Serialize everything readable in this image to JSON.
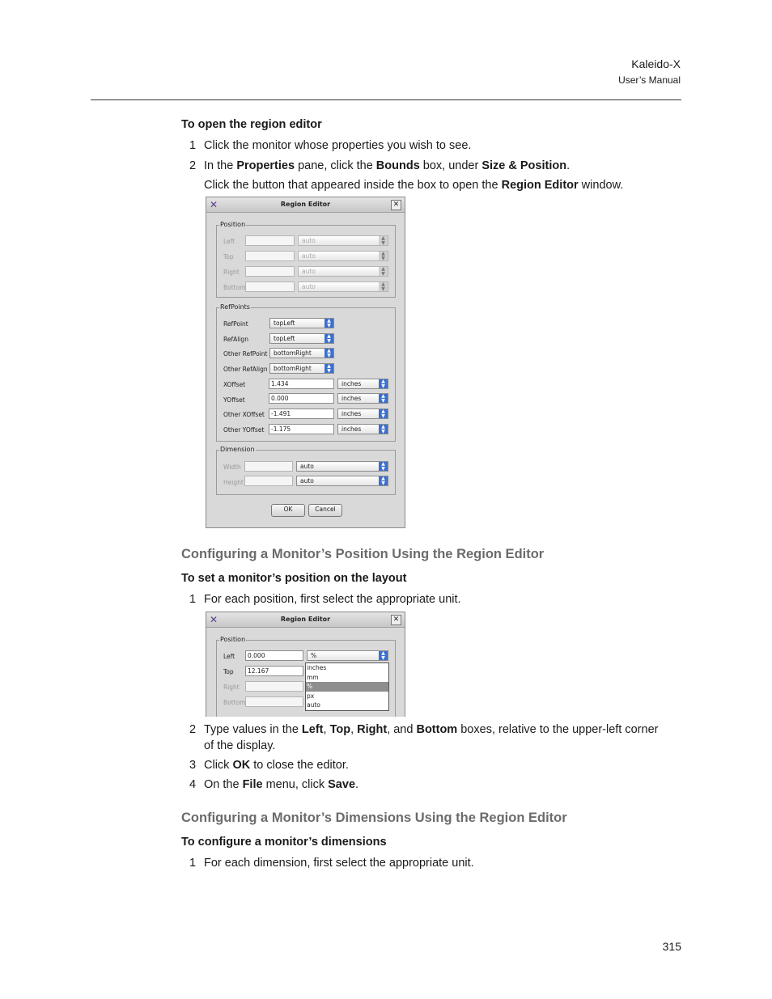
{
  "header": {
    "product": "Kaleido-X",
    "manual": "User’s Manual"
  },
  "page_number": "315",
  "procedure1": {
    "title": "To open the region editor",
    "step1_num": "1",
    "step1": "Click the monitor whose properties you wish to see.",
    "step2_num": "2",
    "step2_a": "In the ",
    "step2_b": "Properties",
    "step2_c": " pane, click the ",
    "step2_d": "Bounds",
    "step2_e": " box, under ",
    "step2_f": "Size & Position",
    "step2_g": ".",
    "step2_note_a": "Click the button that appeared inside the box to open the ",
    "step2_note_b": "Region Editor",
    "step2_note_c": " window."
  },
  "dialog1": {
    "title": "Region Editor",
    "position_group": "Position",
    "pos_labels": [
      "Left",
      "Top",
      "Right",
      "Bottom"
    ],
    "pos_unit": "auto",
    "refpoints_group": "RefPoints",
    "ref_labels": [
      "RefPoint",
      "RefAlign",
      "Other RefPoint",
      "Other RefAlign"
    ],
    "ref_values": [
      "topLeft",
      "topLeft",
      "bottomRight",
      "bottomRight"
    ],
    "offset_labels": [
      "XOffset",
      "YOffset",
      "Other XOffset",
      "Other YOffset"
    ],
    "offset_values": [
      "1.434",
      "0.000",
      "-1.491",
      "-1.175"
    ],
    "offset_unit": "inches",
    "dimension_group": "Dimension",
    "dim_labels": [
      "Width",
      "Height"
    ],
    "dim_unit": "auto",
    "ok": "OK",
    "cancel": "Cancel"
  },
  "section1": {
    "title": "Configuring a Monitor’s Position Using the Region Editor"
  },
  "procedure2": {
    "title": "To set a monitor’s position on the layout",
    "step1_num": "1",
    "step1": "For each position, first select the appropriate unit."
  },
  "dialog2": {
    "title": "Region Editor",
    "position_group": "Position",
    "pos_labels": [
      "Left",
      "Top",
      "Right",
      "Bottom"
    ],
    "left_value": "0.000",
    "top_value": "12.167",
    "selected_unit": "%",
    "unit_options": [
      "inches",
      "mm",
      "%",
      "px",
      "auto"
    ]
  },
  "procedure2b": {
    "step2_num": "2",
    "step2_a": "Type values in the ",
    "step2_b": "Left",
    "step2_c": ", ",
    "step2_d": "Top",
    "step2_e": ", ",
    "step2_f": "Right",
    "step2_g": ", and ",
    "step2_h": "Bottom",
    "step2_i": " boxes, relative to the upper-left corner",
    "step2_j": "of the display.",
    "step3_num": "3",
    "step3_a": "Click ",
    "step3_b": "OK",
    "step3_c": " to close the editor.",
    "step4_num": "4",
    "step4_a": "On the ",
    "step4_b": "File",
    "step4_c": " menu, click ",
    "step4_d": "Save",
    "step4_e": "."
  },
  "section2": {
    "title": "Configuring a Monitor’s Dimensions Using the Region Editor"
  },
  "procedure3": {
    "title": "To configure a monitor’s dimensions",
    "step1_num": "1",
    "step1": "For each dimension, first select the appropriate unit."
  }
}
